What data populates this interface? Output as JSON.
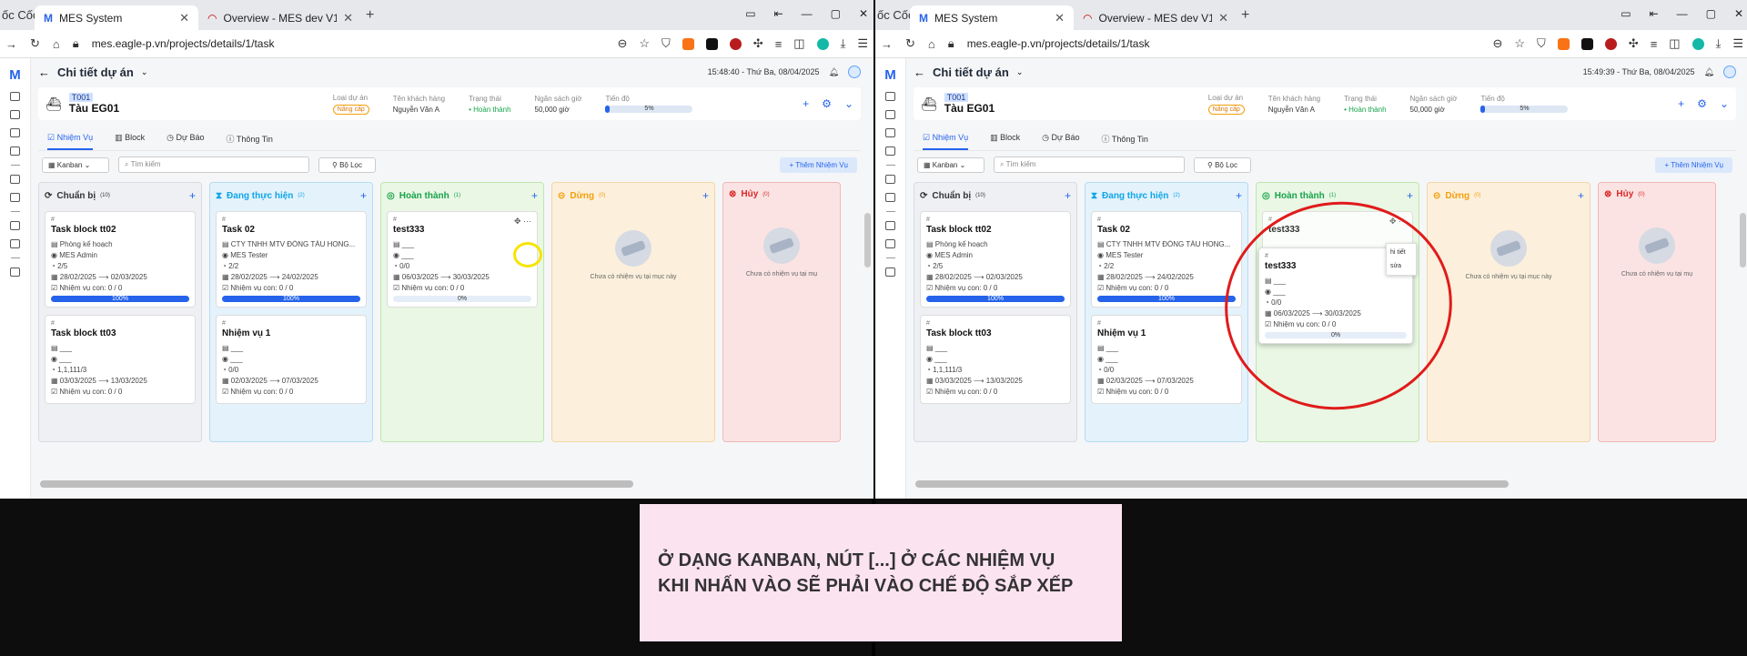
{
  "note": {
    "line1": "Ở DẠNG KANBAN, NÚT [...] Ở CÁC NHIỆM VỤ",
    "line2": "KHI NHẤN VÀO SẼ PHẢI VÀO CHẾ ĐỘ SẮP XẾP"
  },
  "browser": {
    "brand": "ốc Cốc",
    "tabs": [
      {
        "title": "MES System"
      },
      {
        "title": "Overview - MES dev V1 - Redmine"
      }
    ],
    "url": "mes.eagle-p.vn/projects/details/1/task"
  },
  "colors": {
    "accent": "#2563eb",
    "col1": "#eef0f4",
    "col2": "#e4f2fb",
    "col3": "#e9f7e4",
    "col4": "#fcf0dc",
    "col5": "#fbe3e3"
  },
  "app": {
    "page_title": "Chi tiết dự án",
    "timestamp_left": "15:48:40 - Thứ Ba, 08/04/2025",
    "timestamp_right": "15:49:39 - Thứ Ba, 08/04/2025",
    "project": {
      "code": "T001",
      "name": "Tàu EG01",
      "type_label": "Loại dự án",
      "type": "Nâng cấp",
      "customer_label": "Tên khách hàng",
      "customer": "Nguyễn Văn A",
      "status_label": "Trạng thái",
      "status": "Hoàn thành",
      "budget_label": "Ngân sách giờ",
      "budget": "50,000 giờ",
      "progress_label": "Tiến độ",
      "progress": "5%",
      "progress_value": 5
    },
    "tabs": [
      "Nhiệm Vụ",
      "Block",
      "Dự Báo",
      "Thông Tin"
    ],
    "view_select": "Kanban",
    "search_placeholder": "Tìm kiếm",
    "filter_label": "Bộ Lọc",
    "add_task": "+ Thêm Nhiệm Vụ",
    "empty_text": "Chưa có nhiệm vụ tại mục này",
    "empty_text_cut": "Chưa có nhiệm vụ tại mụ",
    "columns": [
      {
        "title": "Chuẩn bị",
        "count": "(10)"
      },
      {
        "title": "Đang thực hiện",
        "count": "(2)"
      },
      {
        "title": "Hoàn thành",
        "count": "(1)"
      },
      {
        "title": "Dừng",
        "count": "(0)"
      },
      {
        "title": "Hủy",
        "count": "(0)"
      }
    ],
    "cards": {
      "c1": {
        "hash": "#",
        "name": "Task block tt02",
        "dept": "Phòng kế hoạch",
        "user": "MES Admin",
        "ratio": "2/5",
        "dates": "28/02/2025 ⟶ 02/03/2025",
        "sub": "Nhiệm vụ con: 0 / 0",
        "progress": "100%",
        "pv": 100
      },
      "c2": {
        "hash": "#",
        "name": "Task block tt03",
        "dept": "___",
        "user": "___",
        "ratio": "1,1,111/3",
        "dates": "03/03/2025 ⟶ 13/03/2025",
        "sub": "Nhiệm vụ con: 0 / 0"
      },
      "c3": {
        "hash": "#",
        "name": "Task 02",
        "dept": "CTY TNHH MTV ĐÓNG TÀU HONG...",
        "user": "MES Tester",
        "ratio": "2/2",
        "dates": "28/02/2025 ⟶ 24/02/2025",
        "sub": "Nhiệm vụ con: 0 / 0",
        "progress": "100%",
        "pv": 100
      },
      "c4": {
        "hash": "#",
        "name": "Nhiệm vụ 1",
        "dept": "___",
        "user": "___",
        "ratio": "0/0",
        "dates": "02/03/2025 ⟶ 07/03/2025",
        "sub": "Nhiệm vụ con: 0 / 0"
      },
      "c5": {
        "hash": "#",
        "name": "test333",
        "dept": "___",
        "user": "___",
        "ratio": "0/0",
        "dates": "06/03/2025 ⟶ 30/03/2025",
        "sub": "Nhiệm vụ con: 0 / 0",
        "progress": "0%",
        "pv": 0
      }
    },
    "menu": {
      "item1": "hi tiết",
      "item2": "sửa"
    },
    "more": "···"
  }
}
